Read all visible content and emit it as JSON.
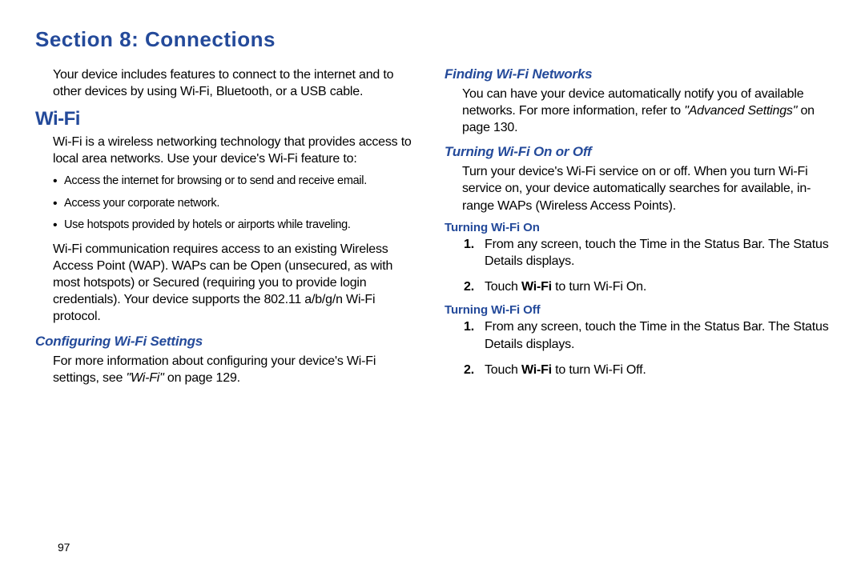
{
  "section_title": "Section 8: Connections",
  "page_number": "97",
  "left": {
    "intro": "Your device includes features to connect to the internet and to other devices by using Wi-Fi, Bluetooth, or a USB cable.",
    "wifi_heading": "Wi-Fi",
    "wifi_intro": "Wi-Fi is a wireless networking technology that provides access to local area networks. Use your device's Wi-Fi feature to:",
    "bullets": {
      "b1": "Access the internet for browsing or to send and receive email.",
      "b2": "Access your corporate network.",
      "b3": "Use hotspots provided by hotels or airports while traveling."
    },
    "wap_para": "Wi-Fi communication requires access to an existing Wireless Access Point (WAP). WAPs can be Open (unsecured, as with most hotspots) or Secured (requiring you to provide login credentials). Your device supports the 802.11 a/b/g/n Wi-Fi protocol.",
    "configuring_heading": "Configuring Wi-Fi Settings",
    "configuring_para_pre": "For more information about configuring your device's Wi-Fi settings, see ",
    "configuring_para_ref": "\"Wi-Fi\"",
    "configuring_para_post": " on page 129."
  },
  "right": {
    "finding_heading": "Finding Wi-Fi Networks",
    "finding_para_pre": "You can have your device automatically notify you of available networks. For more information, refer to ",
    "finding_para_ref": "\"Advanced Settings\"",
    "finding_para_post": " on page 130.",
    "turning_onoff_heading": "Turning Wi-Fi On or Off",
    "turning_onoff_para": "Turn your device's Wi-Fi service on or off. When you turn Wi-Fi service on, your device automatically searches for available, in-range WAPs (Wireless Access Points).",
    "turning_on_heading": "Turning Wi-Fi On",
    "on_steps": {
      "s1": "From any screen, touch the Time in the Status Bar. The Status Details displays.",
      "s2_pre": "Touch ",
      "s2_bold": "Wi-Fi",
      "s2_post": " to turn Wi-Fi On."
    },
    "turning_off_heading": "Turning Wi-Fi Off",
    "off_steps": {
      "s1": "From any screen, touch the Time in the Status Bar. The Status Details displays.",
      "s2_pre": "Touch ",
      "s2_bold": "Wi-Fi",
      "s2_post": " to turn Wi-Fi Off."
    }
  }
}
